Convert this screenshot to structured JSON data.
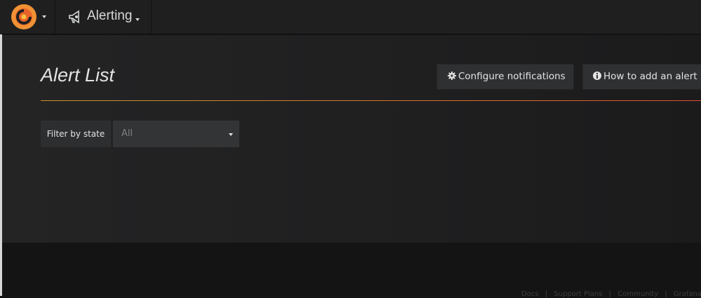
{
  "navbar": {
    "logo_icon": "grafana-logo-icon",
    "section": {
      "icon": "megaphone-icon",
      "title": "Alerting"
    }
  },
  "page": {
    "title": "Alert List",
    "buttons": {
      "configure": {
        "icon": "gear-icon",
        "label": "Configure notifications"
      },
      "howto": {
        "icon": "info-circle-icon",
        "label": "How to add an alert"
      }
    }
  },
  "filter": {
    "label": "Filter by state",
    "selected": "All"
  },
  "footer": {
    "links": [
      "Docs",
      "Support Plans",
      "Community",
      "Grafana"
    ],
    "separator": "|"
  },
  "colors": {
    "accent_start": "#c7912f",
    "accent_end": "#e04b2c",
    "background": "#1f1f20"
  }
}
